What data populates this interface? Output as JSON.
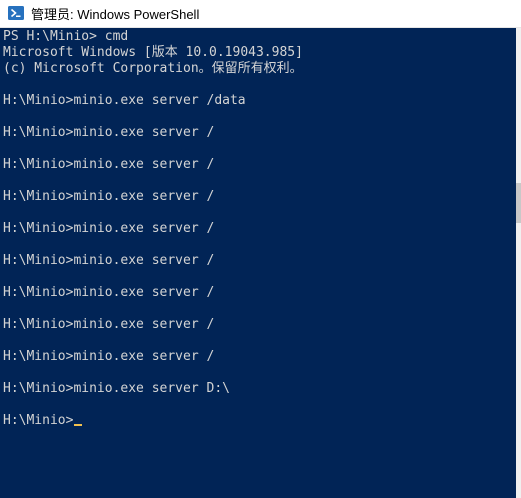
{
  "window": {
    "title": "管理员: Windows PowerShell",
    "icon": "powershell-icon"
  },
  "console": {
    "background": "#012456",
    "foreground": "#d4d4d4",
    "lines": [
      "PS H:\\Minio> cmd",
      "Microsoft Windows [版本 10.0.19043.985]",
      "(c) Microsoft Corporation。保留所有权利。",
      "H:\\Minio>minio.exe server /data",
      "H:\\Minio>minio.exe server /",
      "H:\\Minio>minio.exe server /",
      "H:\\Minio>minio.exe server /",
      "H:\\Minio>minio.exe server /",
      "H:\\Minio>minio.exe server /",
      "H:\\Minio>minio.exe server /",
      "H:\\Minio>minio.exe server /",
      "H:\\Minio>minio.exe server /",
      "H:\\Minio>minio.exe server D:\\",
      "H:\\Minio>"
    ]
  }
}
